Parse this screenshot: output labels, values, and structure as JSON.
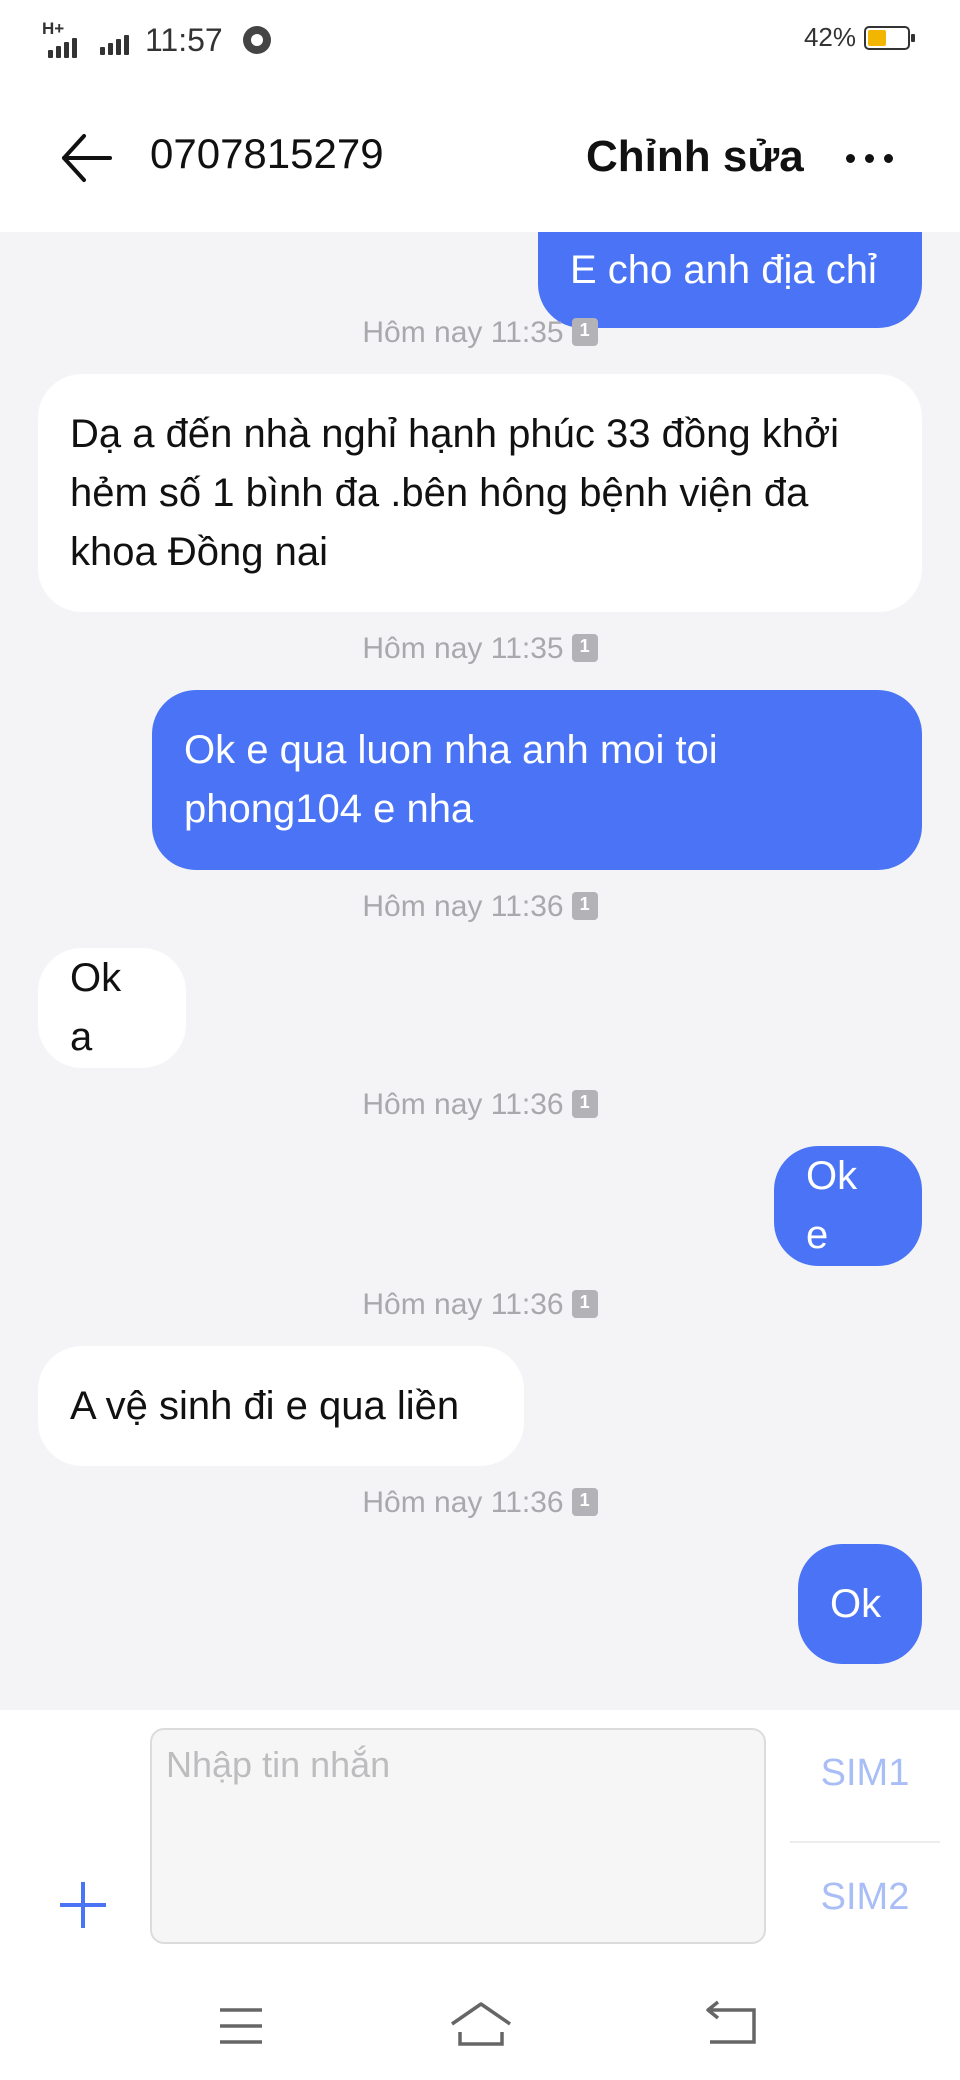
{
  "status_bar": {
    "network": "H+",
    "time": "11:57",
    "battery_percent": "42%",
    "battery_level": 0.42,
    "battery_color": "#f2b600"
  },
  "header": {
    "back_icon": "arrow-left-icon",
    "title": "0707815279",
    "edit_label": "Chỉnh sửa",
    "more_icon": "more-horizontal-icon"
  },
  "messages": [
    {
      "direction": "out",
      "text": "E cho anh địa chỉ"
    },
    {
      "timestamp": "Hôm nay 11:35"
    },
    {
      "direction": "in",
      "text": "Dạ a đến nhà nghỉ hạnh phúc 33 đồng khởi hẻm số 1 bình đa .bên hông bệnh viện đa khoa Đồng nai"
    },
    {
      "timestamp": "Hôm nay 11:35"
    },
    {
      "direction": "out",
      "text": "Ok e qua luon nha anh moi toi phong104 e nha"
    },
    {
      "timestamp": "Hôm nay 11:36"
    },
    {
      "direction": "in",
      "text": "Ok a"
    },
    {
      "timestamp": "Hôm nay 11:36"
    },
    {
      "direction": "out",
      "text": "Ok e"
    },
    {
      "timestamp": "Hôm nay 11:36"
    },
    {
      "direction": "in",
      "text": "A vệ sinh đi e qua liền"
    },
    {
      "timestamp": "Hôm nay 11:36"
    },
    {
      "direction": "out",
      "text": "Ok"
    }
  ],
  "compose": {
    "placeholder": "Nhập tin nhắn",
    "value": "",
    "add_icon": "plus-icon",
    "sim1_label": "SIM1",
    "sim2_label": "SIM2"
  },
  "nav_bar": {
    "menu_icon": "menu-icon",
    "home_icon": "home-icon",
    "back_icon": "back-icon"
  },
  "colors": {
    "outgoing_bubble": "#4a74f5",
    "incoming_bubble": "#ffffff",
    "chat_background": "#f4f4f6",
    "accent": "#4a74f5"
  }
}
